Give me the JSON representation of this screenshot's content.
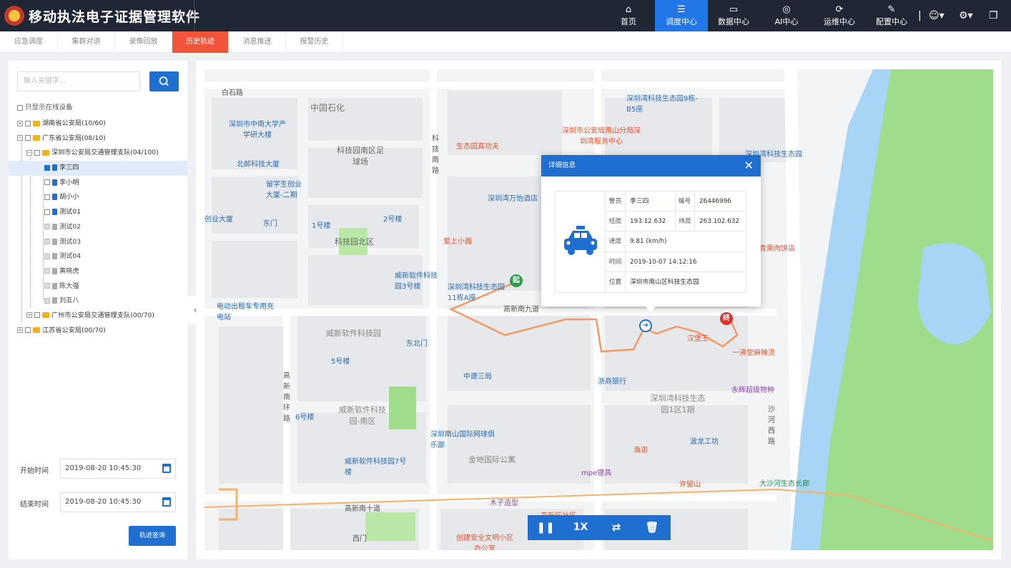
{
  "header": {
    "title": "移动执法电子证据管理软件",
    "nav": [
      {
        "label": "首页",
        "icon": "home-icon"
      },
      {
        "label": "调度中心",
        "icon": "sliders-icon"
      },
      {
        "label": "数据中心",
        "icon": "monitor-icon"
      },
      {
        "label": "AI中心",
        "icon": "ai-scan-icon"
      },
      {
        "label": "运维中心",
        "icon": "refresh-icon"
      },
      {
        "label": "配置中心",
        "icon": "wrench-icon"
      }
    ],
    "active_nav": "调度中心"
  },
  "subtabs": [
    "应急调度",
    "集群对讲",
    "录像回放",
    "历史轨迹",
    "消息推送",
    "报警历史"
  ],
  "active_subtab": "历史轨迹",
  "sidebar": {
    "search_placeholder": "输入关键字...",
    "online_only_label": "只显示在线设备",
    "tree": [
      {
        "label": "湖南省公安局(10/60)"
      },
      {
        "label": "广东省公安局(08/10)"
      },
      {
        "label": "深圳市公安局交通管理支队(04/100)"
      },
      {
        "label": "李三四"
      },
      {
        "label": "李小明"
      },
      {
        "label": "胡小小"
      },
      {
        "label": "测试01"
      },
      {
        "label": "测试02"
      },
      {
        "label": "测试03"
      },
      {
        "label": "测试04"
      },
      {
        "label": "黄晓虎"
      },
      {
        "label": "陈大强"
      },
      {
        "label": "刘五八"
      },
      {
        "label": "广州市公安局交通管理支队(00/70)"
      },
      {
        "label": "江苏省公安局(00/70)"
      }
    ],
    "start_label": "开始时间",
    "start_value": "2019-08-20  10:45:30",
    "end_label": "结束时间",
    "end_value": "2019-08-20  10:45:30",
    "query_button": "轨迹查询"
  },
  "popup": {
    "title": "详细信息",
    "officer_label": "警员",
    "officer_value": "李三四",
    "id_label": "编号",
    "id_value": "26446996",
    "lng_label": "经度",
    "lng_value": "193.12.632",
    "lat_label": "纬度",
    "lat_value": "263.102.632",
    "speed_label": "速度",
    "speed_value": "9.81 (km/h)",
    "time_label": "时间",
    "time_value": "2019-10-07 14:12:16",
    "location_label": "位置",
    "location_value": "深圳市南山区科技生态园"
  },
  "playback": {
    "speed": "1X"
  },
  "map": {
    "start_marker": "起",
    "end_marker": "终",
    "labels": [
      "白石路",
      "中国石化",
      "科技园南区足球场",
      "深圳市中南大学产学研大楼",
      "北邮科技大厦",
      "留学生创业大厦-二期",
      "1号楼",
      "2号楼",
      "科技园北区",
      "威新软件科技园3号楼",
      "深圳湾科技生态园11栋A座",
      "深圳湾万怡酒店",
      "爱上小面",
      "生态园真功夫",
      "深圳市公安局南山分局深圳湾服务中心",
      "深圳湾科技生态园9栋-B5座",
      "深圳湾科技生态园",
      "高新南九道",
      "电动出租车专用充电站",
      "威新软件科技园",
      "东北门",
      "5号楼",
      "中建三局",
      "威新软件科技园-南区",
      "6号楼",
      "深圳南山国际网球俱乐部",
      "金地国际公寓",
      "威新软件科技园7号楼",
      "高新南十道",
      "木子造型",
      "创建安全文明小区办公室",
      "浙商银行",
      "汉堡王",
      "一沸堂麻辣烫",
      "永辉超级物种",
      "深圳湾科技生态园1区1期",
      "渔迦",
      "波龙工坊",
      "mpe寝具",
      "许留山",
      "大沙河生态长廊",
      "沙河西路",
      "高新南环路",
      "科技南路",
      "连贵熏肉饼店",
      "创业大厦",
      "东门",
      "西门",
      "高新区社区"
    ]
  },
  "colors": {
    "accent": "#1f6fd1",
    "active_tab": "#f0553a",
    "topbar": "#1f2735",
    "track": "#f39a62",
    "river": "#a8d4f5",
    "park": "#9fdd8c"
  }
}
